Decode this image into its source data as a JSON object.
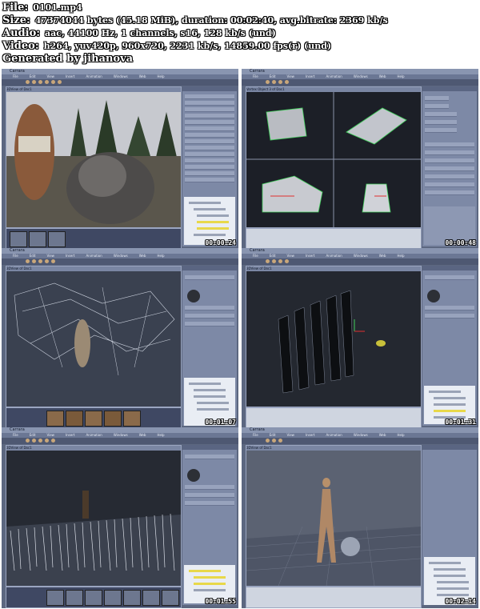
{
  "info": {
    "file_label": "File:",
    "file_value": "0101.mp4",
    "size_label": "Size:",
    "size_value": "47374044 bytes (45.18 MiB), duration: 00:02:40, avg.bitrate: 2369 kb/s",
    "audio_label": "Audio:",
    "audio_value": "aac, 44100 Hz, 1 channels, s16, 128 kb/s (und)",
    "video_label": "Video:",
    "video_value": "h264, yuv420p, 960x720, 2231 kb/s, 14859.00 fps(r) (und)",
    "generated": "Generated by jihanova"
  },
  "thumbs": [
    {
      "window_title": "Carrara",
      "view_title": "3DView of Doc1",
      "timecode": "00:00:24"
    },
    {
      "window_title": "Carrara",
      "view_title": "Vertex Object 3 of Doc1",
      "timecode": "00:00:48"
    },
    {
      "window_title": "Carrara",
      "view_title": "3DView of Doc1",
      "timecode": "00:01:07"
    },
    {
      "window_title": "Carrara",
      "view_title": "3DView of Doc1",
      "timecode": "00:01:31"
    },
    {
      "window_title": "Carrara",
      "view_title": "3DView of Doc1",
      "timecode": "00:01:55"
    },
    {
      "window_title": "Carrara",
      "view_title": "3DView of Doc1",
      "timecode": "00:02:14"
    }
  ],
  "menus": [
    "File",
    "Edit",
    "View",
    "Insert",
    "Animation",
    "Windows",
    "Web",
    "Help"
  ],
  "colors": {
    "ui_panel": "#7d89a6",
    "ui_dark": "#222630",
    "timecode": "#ffffff"
  }
}
